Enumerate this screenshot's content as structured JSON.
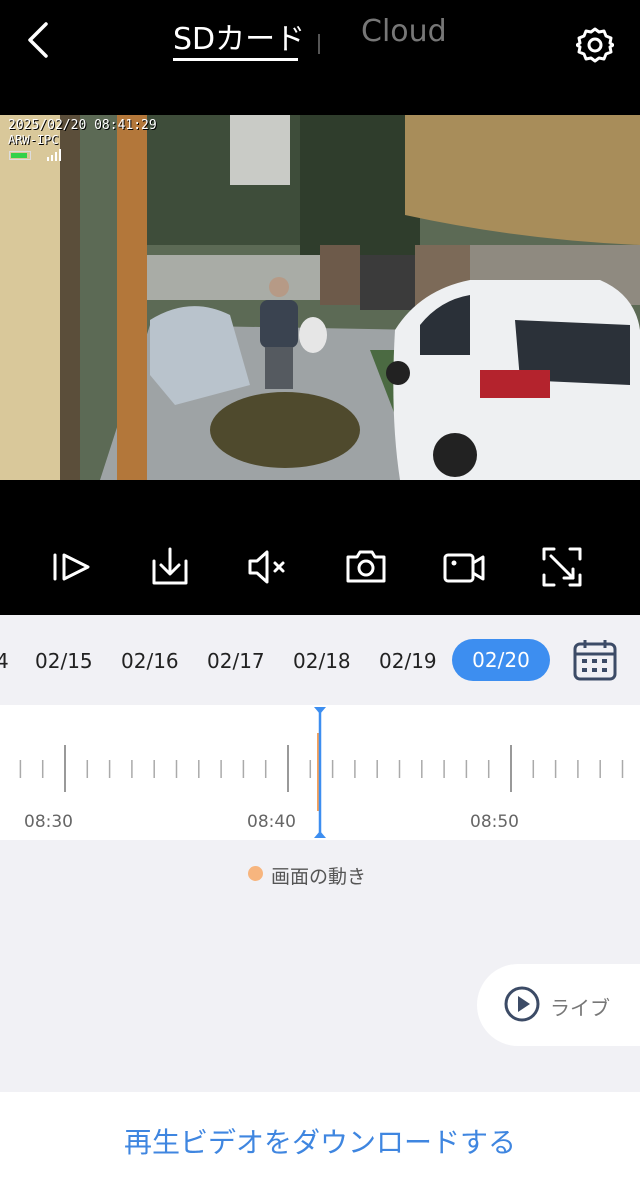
{
  "header": {
    "tabs": [
      {
        "label": "SDカード",
        "active": true
      },
      {
        "label": "Cloud",
        "active": false
      }
    ],
    "back_icon": "chevron-left-icon",
    "settings_icon": "gear-icon"
  },
  "video": {
    "timestamp": "2025/02/20 08:41:29",
    "camera_name": "ARW-IPC"
  },
  "controls": [
    {
      "name": "play-forward-icon"
    },
    {
      "name": "download-icon"
    },
    {
      "name": "mute-icon"
    },
    {
      "name": "camera-icon"
    },
    {
      "name": "record-icon"
    },
    {
      "name": "fullscreen-icon"
    }
  ],
  "dates": {
    "partial": "4",
    "items": [
      "02/15",
      "02/16",
      "02/17",
      "02/18",
      "02/19"
    ],
    "selected": "02/20"
  },
  "timeline": {
    "labels": [
      "08:30",
      "08:40",
      "08:50"
    ],
    "cursor_color": "#3d8ef0",
    "event_color": "#f7a25a"
  },
  "legend": {
    "label": "画面の動き",
    "color": "#f7b57e"
  },
  "live": {
    "label": "ライブ"
  },
  "bottom": {
    "download_label": "再生ビデオをダウンロードする"
  }
}
